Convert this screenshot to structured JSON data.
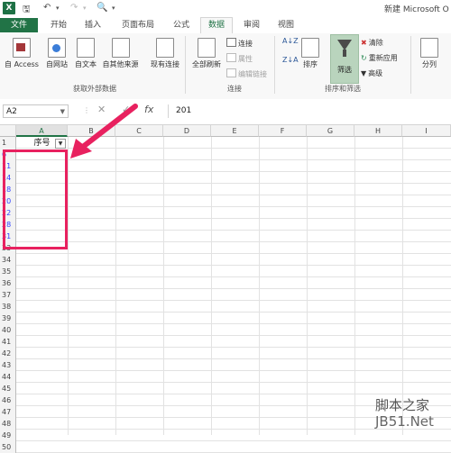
{
  "window": {
    "title": "新建 Microsoft O"
  },
  "tabs": [
    "文件",
    "开始",
    "插入",
    "页面布局",
    "公式",
    "数据",
    "审阅",
    "视图"
  ],
  "ribbon": {
    "external": {
      "access": "自 Access",
      "web": "自网站",
      "text": "自文本",
      "other": "自其他来源",
      "existing": "现有连接",
      "group": "获取外部数据"
    },
    "connections": {
      "refresh_all": "全部刷新",
      "connections": "连接",
      "properties": "属性",
      "edit_links": "编辑链接",
      "group": "连接"
    },
    "sortfilter": {
      "sort": "排序",
      "filter": "筛选",
      "clear": "清除",
      "reapply": "重新应用",
      "advanced": "高级",
      "group": "排序和筛选"
    },
    "datatools": {
      "split": "分列"
    }
  },
  "formula_bar": {
    "name_box": "A2",
    "fx": "fx",
    "value": "201"
  },
  "columns": [
    "A",
    "B",
    "C",
    "D",
    "E",
    "F",
    "G",
    "H",
    "I"
  ],
  "header_row": {
    "row_num": "1",
    "cell_text": "序号"
  },
  "rows": [
    "6",
    "11",
    "14",
    "18",
    "20",
    "22",
    "28",
    "31",
    "33",
    "34",
    "35",
    "36",
    "37",
    "38",
    "39",
    "40",
    "41",
    "42",
    "43",
    "44",
    "45",
    "46",
    "47",
    "48",
    "49",
    "50"
  ],
  "watermark": {
    "line1": "脚本之家",
    "line2": "JB51.Net"
  },
  "colors": {
    "accent": "#217346",
    "annotation": "#e8215f",
    "filtered_row": "#2f3fff"
  }
}
